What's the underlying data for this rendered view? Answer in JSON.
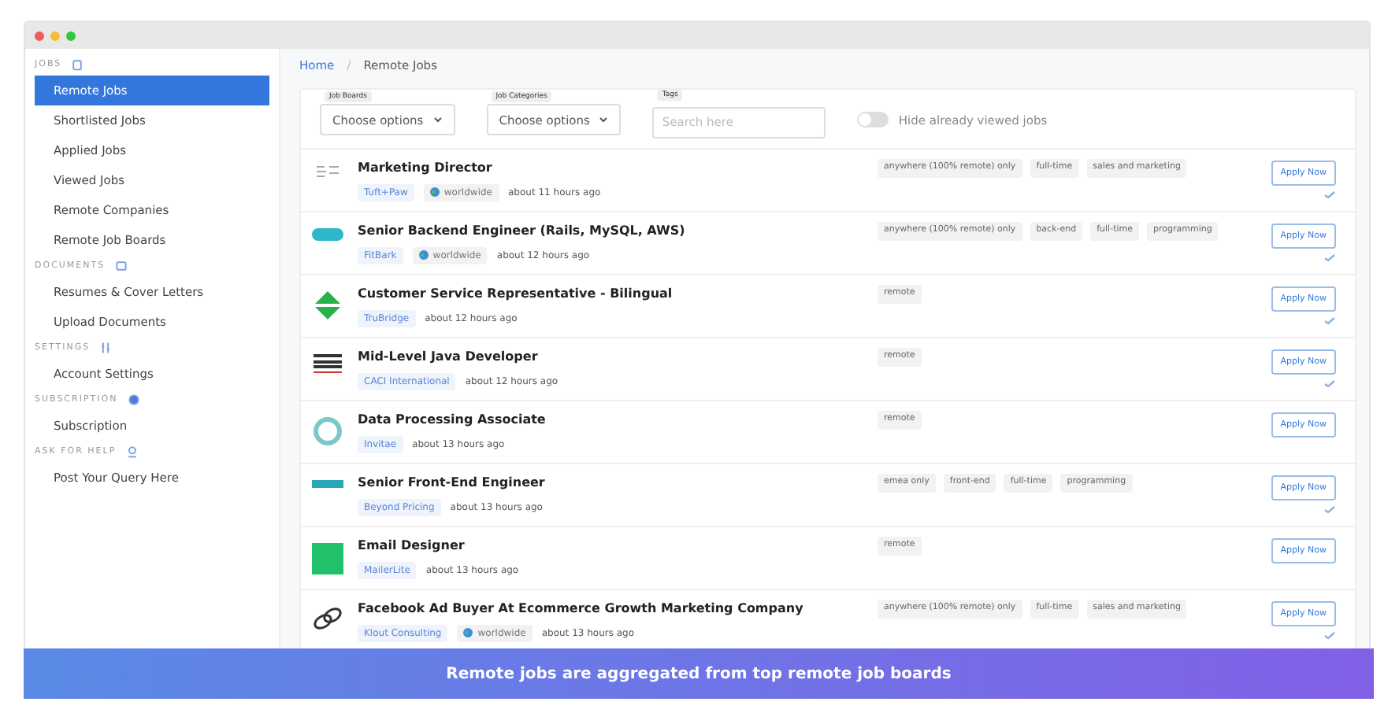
{
  "sidebar": {
    "sections": [
      {
        "heading": "JOBS",
        "items": [
          {
            "label": "Remote Jobs",
            "selected": true
          },
          {
            "label": "Shortlisted Jobs",
            "selected": false
          },
          {
            "label": "Applied Jobs",
            "selected": false
          },
          {
            "label": "Viewed Jobs",
            "selected": false
          },
          {
            "label": "Remote Companies",
            "selected": false
          },
          {
            "label": "Remote Job Boards",
            "selected": false
          }
        ]
      },
      {
        "heading": "DOCUMENTS",
        "items": [
          {
            "label": "Resumes & Cover Letters",
            "selected": false
          },
          {
            "label": "Upload Documents",
            "selected": false
          }
        ]
      },
      {
        "heading": "SETTINGS",
        "items": [
          {
            "label": "Account Settings",
            "selected": false
          }
        ]
      },
      {
        "heading": "SUBSCRIPTION",
        "items": [
          {
            "label": "Subscription",
            "selected": false
          }
        ]
      },
      {
        "heading": "ASK FOR HELP",
        "items": [
          {
            "label": "Post Your Query Here",
            "selected": false
          }
        ]
      }
    ]
  },
  "breadcrumb": {
    "separator": "/",
    "items": [
      {
        "label": "Home"
      },
      {
        "label": "Remote Jobs"
      }
    ]
  },
  "filters": {
    "job_boards": {
      "label": "Job Boards",
      "value": "Choose options"
    },
    "job_categories": {
      "label": "Job Categories",
      "value": "Choose options"
    },
    "tags": {
      "label": "Tags",
      "placeholder": "Search here"
    },
    "hide_viewed": {
      "label": "Hide already viewed jobs",
      "on": false
    }
  },
  "jobs": [
    {
      "kind": "text-mark",
      "title": "Marketing Director",
      "company": "Tuft+Paw",
      "location": "worldwide",
      "posted": "about 11 hours ago",
      "tags": [
        "anywhere (100% remote) only",
        "full-time",
        "sales and marketing"
      ],
      "button": "Apply Now",
      "viewed": true
    },
    {
      "kind": "bone",
      "title": "Senior Backend Engineer (Rails, MySQL, AWS)",
      "company": "FitBark",
      "location": "worldwide",
      "posted": "about 12 hours ago",
      "tags": [
        "anywhere (100% remote) only",
        "back-end",
        "full-time",
        "programming"
      ],
      "button": "Apply Now",
      "viewed": true
    },
    {
      "kind": "arrows",
      "title": "Customer Service Representative - Bilingual",
      "company": "TruBridge",
      "posted": "about 12 hours ago",
      "tags": [
        "remote"
      ],
      "button": "Apply Now",
      "viewed": true
    },
    {
      "kind": "serif-mark",
      "title": "Mid-Level Java Developer",
      "company": "CACI International",
      "posted": "about 12 hours ago",
      "tags": [
        "remote"
      ],
      "button": "Apply Now",
      "viewed": true
    },
    {
      "kind": "ring",
      "title": "Data Processing Associate",
      "company": "Invitae",
      "posted": "about 13 hours ago",
      "tags": [
        "remote"
      ],
      "button": "Apply Now",
      "viewed": false
    },
    {
      "kind": "bar",
      "title": "Senior Front-End Engineer",
      "company": "Beyond Pricing",
      "posted": "about 13 hours ago",
      "tags": [
        "emea only",
        "front-end",
        "full-time",
        "programming"
      ],
      "button": "Apply Now",
      "viewed": true
    },
    {
      "kind": "square",
      "title": "Email Designer",
      "company": "MailerLite",
      "posted": "about 13 hours ago",
      "tags": [
        "remote"
      ],
      "button": "Apply Now",
      "viewed": false
    },
    {
      "kind": "chain",
      "title": "Facebook Ad Buyer At Ecommerce Growth Marketing Company",
      "company": "Klout Consulting",
      "location": "worldwide",
      "posted": "about 13 hours ago",
      "tags": [
        "anywhere (100% remote) only",
        "full-time",
        "sales and marketing"
      ],
      "button": "Apply Now",
      "viewed": true
    }
  ],
  "banner": {
    "text": "Remote jobs are aggregated from top remote job boards"
  }
}
